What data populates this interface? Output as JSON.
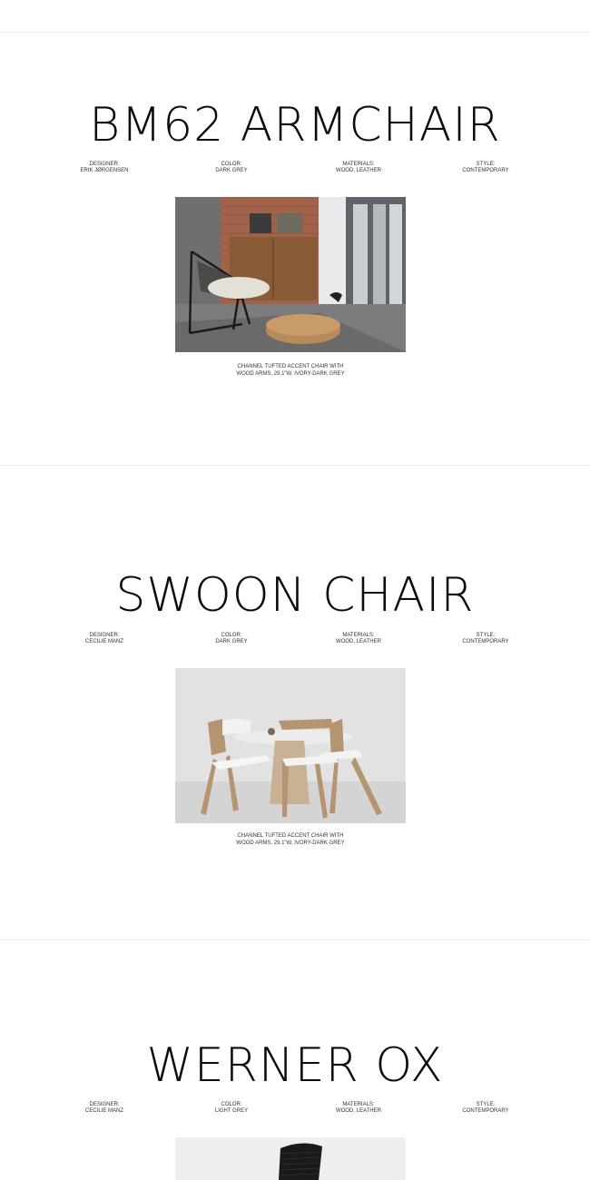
{
  "products": [
    {
      "title": "BM62 ARMCHAIR",
      "specs": [
        {
          "label": "DESIGNER:",
          "value": "ERIK JØRGENSEN"
        },
        {
          "label": "COLOR:",
          "value": "DARK GREY"
        },
        {
          "label": "MATERIALS:",
          "value": "WOOD, LEATHER"
        },
        {
          "label": "STYLE:",
          "value": "CONTEMPORARY"
        }
      ],
      "caption": "CHANNEL TUFTED ACCENT CHAIR WITH WOOD ARMS, 29.1\"W, IVORY-DARK GREY"
    },
    {
      "title": "SWOON CHAIR",
      "specs": [
        {
          "label": "DESIGNER:",
          "value": "CECILIE MANZ"
        },
        {
          "label": "COLOR:",
          "value": "DARK GREY"
        },
        {
          "label": "MATERIALS:",
          "value": "WOOD, LEATHER"
        },
        {
          "label": "STYLE:",
          "value": "CONTEMPORARY"
        }
      ],
      "caption": "CHANNEL TUFTED ACCENT CHAIR WITH WOOD ARMS, 29.1\"W, IVORY-DARK GREY"
    },
    {
      "title": "WERNER OX",
      "specs": [
        {
          "label": "DESIGNER:",
          "value": "CECILIE MANZ"
        },
        {
          "label": "COLOR:",
          "value": "LIGHT GREY"
        },
        {
          "label": "MATERIALS:",
          "value": "WOOD, LEATHER"
        },
        {
          "label": "STYLE:",
          "value": "CONTEMPORARY"
        }
      ]
    }
  ]
}
